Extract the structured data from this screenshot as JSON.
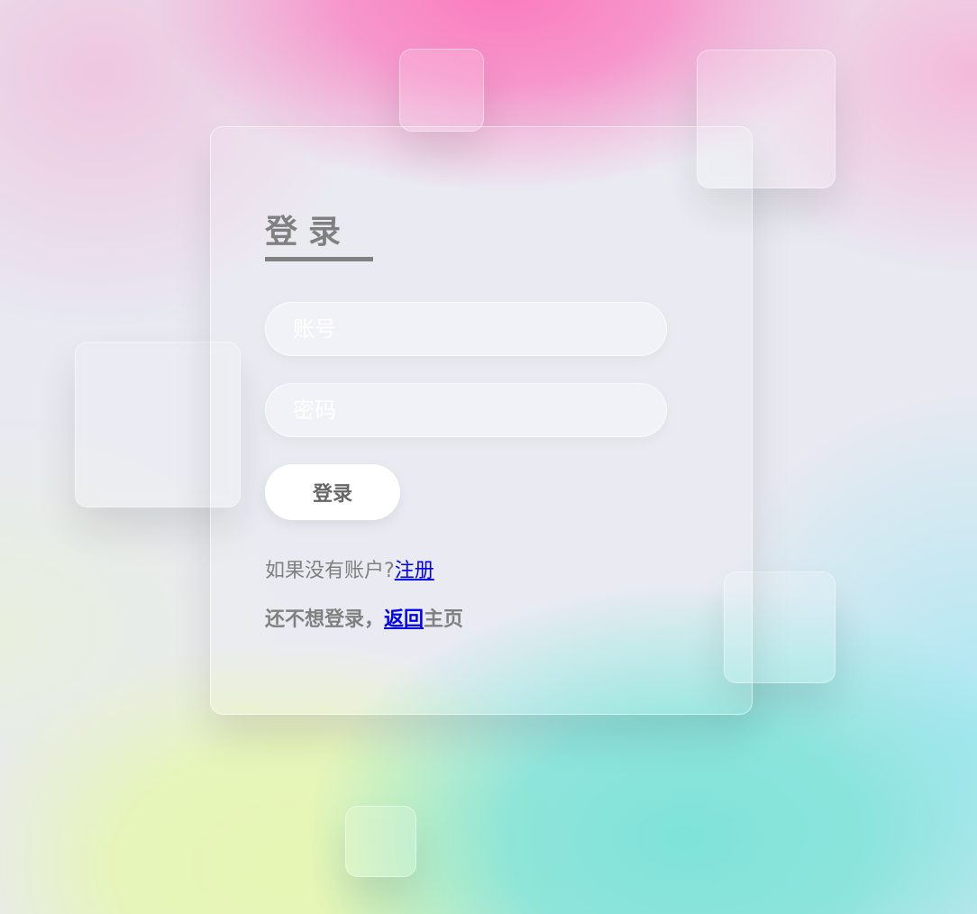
{
  "login": {
    "title": "登录",
    "username_placeholder": "账号",
    "password_placeholder": "密码",
    "submit_label": "登录",
    "register_prompt": "如果没有账户?",
    "register_link": "注册",
    "home_prefix": "还不想登录，",
    "home_link": "返回",
    "home_suffix": "主页"
  },
  "colors": {
    "text_gray": "#808080",
    "link_blue": "#0000ee",
    "button_bg": "#ffffff",
    "accent_pink": "#fb7bbf",
    "accent_teal": "#7fe3d9",
    "accent_lime": "#e6f6b4"
  }
}
